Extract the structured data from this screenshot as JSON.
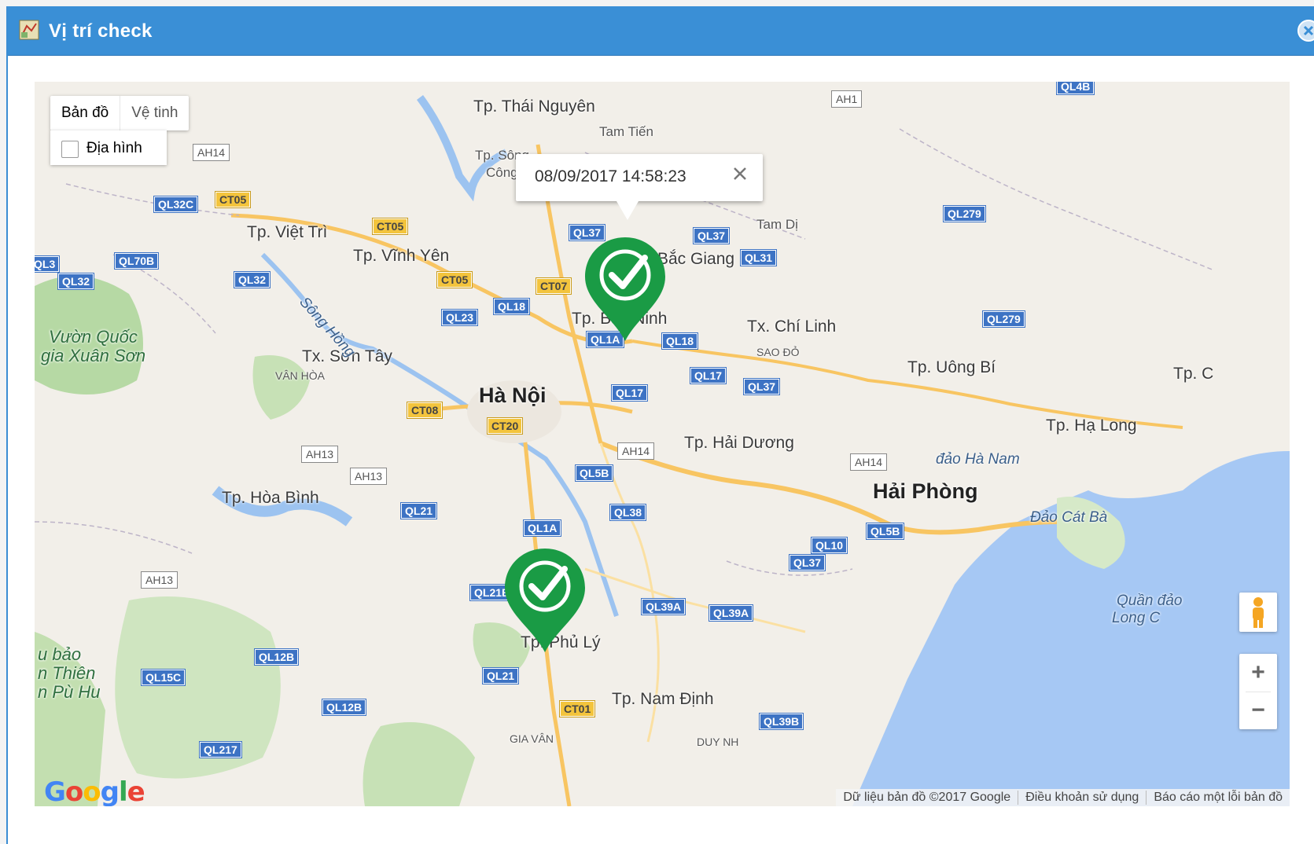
{
  "window": {
    "title": "Vị trí check",
    "title_icon": "map-icon",
    "close_icon": "close-circle-icon"
  },
  "map_controls": {
    "map_type_options": [
      "Bản đồ",
      "Vệ tinh"
    ],
    "selected_map_type": "Bản đồ",
    "terrain_label": "Địa hình",
    "terrain_checked": false,
    "zoom_in": "+",
    "zoom_out": "−",
    "pegman_icon": "street-view-pegman-icon"
  },
  "info_window": {
    "timestamp": "08/09/2017 14:58:23",
    "close_icon": "close-icon"
  },
  "markers": [
    {
      "name": "check-location-marker",
      "icon": "checkmark-pin-icon",
      "color": "#1a9b45",
      "near": "Tp. Bắc Ninh"
    },
    {
      "name": "check-location-marker",
      "icon": "checkmark-pin-icon",
      "color": "#1a9b45",
      "near": "Tp. Phủ Lý"
    }
  ],
  "place_labels": {
    "thai_nguyen": "Tp. Thái Nguyên",
    "tam_tien": "Tam Tiến",
    "song_cong_1": "Tp. Sông",
    "song_cong_2": "Công",
    "tam_di": "Tam Dị",
    "viet_tri": "Tp. Việt Trì",
    "vinh_yen": "Tp. Vĩnh Yên",
    "bac_giang": "Bắc Giang",
    "bac_ninh_a": "Tp. Bắc",
    "bac_ninh_b": "Ninh",
    "chi_linh": "Tx. Chí Linh",
    "sao_do": "SAO ĐỎ",
    "uong_bi": "Tp. Uông Bí",
    "tp_c": "Tp. C",
    "ha_long": "Tp. Hạ Long",
    "dao_ha_nam": "đảo Hà Nam",
    "son_tay": "Tx. Sơn Tây",
    "van_hoa": "VÂN HÒA",
    "ha_noi": "Hà Nội",
    "hai_duong": "Tp. Hải Dương",
    "hai_phong": "Hải Phòng",
    "dao_cat_ba": "Đảo Cát Bà",
    "hoa_binh": "Tp. Hòa Bình",
    "quan_dao_1": "Quần đảo",
    "quan_dao_2": "Long C",
    "phu_ly": "Tp. Phủ Lý",
    "nam_dinh": "Tp. Nam Định",
    "gia_van": "GIA VÂN",
    "duy_nh": "DUY NH",
    "xuan_son_1": "Vườn Quốc",
    "xuan_son_2": "gia Xuân Sơn",
    "pu_hu_1": "u bảo",
    "pu_hu_2": "n Thiên",
    "pu_hu_3": "n Pù Hu",
    "song_hong": "Sông Hồng"
  },
  "road_shields": {
    "national": [
      "QL4B",
      "QL32C",
      "QL70B",
      "QL32",
      "QL32",
      "QL23",
      "QL18",
      "QL37",
      "QL37",
      "QL31",
      "QL279",
      "QL279",
      "QL1A",
      "QL18",
      "QL17",
      "QL37",
      "QL17",
      "QL5B",
      "QL38",
      "QL21",
      "QL1A",
      "QL21B",
      "QL39A",
      "QL39A",
      "QL10",
      "QL37",
      "QL5B",
      "QL12B",
      "QL15C",
      "QL21",
      "QL12B",
      "QL217",
      "QL39B",
      "QL3"
    ],
    "provincial": [
      "CT05",
      "CT05",
      "CT05",
      "CT07",
      "CT08",
      "CT20",
      "CT01"
    ],
    "asian": [
      "AH1",
      "AH14",
      "AH14",
      "AH14",
      "AH13",
      "AH13",
      "AH13"
    ]
  },
  "attribution": {
    "logo": "Google",
    "data": "Dữ liệu bản đồ ©2017 Google",
    "terms": "Điều khoản sử dụng",
    "report": "Báo cáo một lỗi bản đồ"
  },
  "colors": {
    "title_bar": "#3a8fd6",
    "marker_green": "#1a9b45",
    "sea": "#a6c8f4",
    "land": "#f2efe9"
  }
}
